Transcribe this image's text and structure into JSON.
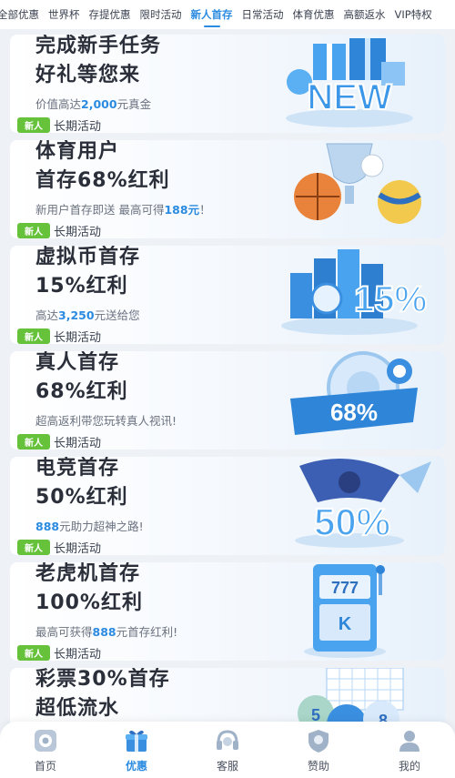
{
  "tabs": [
    {
      "label": "全部优惠"
    },
    {
      "label": "世界杯"
    },
    {
      "label": "存提优惠"
    },
    {
      "label": "限时活动"
    },
    {
      "label": "新人首存"
    },
    {
      "label": "日常活动"
    },
    {
      "label": "体育优惠"
    },
    {
      "label": "高额返水"
    },
    {
      "label": "VIP特权"
    }
  ],
  "active_tab": "新人首存",
  "cards": [
    {
      "title1": "完成新手任务",
      "title2": "好礼等您来",
      "desc_pre": "价值高达",
      "desc_hl": "2,000",
      "desc_post": "元真金",
      "badge": "新人",
      "period": "长期活动",
      "art": "new-gift-boxes"
    },
    {
      "title1": "体育用户",
      "title2": "首存68%红利",
      "desc_pre": "新用户首存即送 最高可得",
      "desc_hl": "188元",
      "desc_post": "！",
      "badge": "新人",
      "period": "长期活动",
      "art": "trophy-balls"
    },
    {
      "title1": "虚拟币首存",
      "title2": "15%红利",
      "desc_pre": "高达",
      "desc_hl": "3,250",
      "desc_post": "元送给您",
      "badge": "新人",
      "period": "长期活动",
      "art": "coin-stacks-15",
      "art_text": "15%"
    },
    {
      "title1": "真人首存",
      "title2": "68%红利",
      "desc_pre": "超高返利带您玩转真人视讯!",
      "desc_hl": "",
      "desc_post": "",
      "badge": "新人",
      "period": "长期活动",
      "art": "roulette-chips",
      "art_text": "68%"
    },
    {
      "title1": "电竞首存",
      "title2": "50%红利",
      "desc_pre": "",
      "desc_hl": "888",
      "desc_post": "元助力超神之路!",
      "badge": "新人",
      "period": "长期活动",
      "art": "esports-hero",
      "art_text": "50%"
    },
    {
      "title1": "老虎机首存",
      "title2": "100%红利",
      "desc_pre": "最高可获得",
      "desc_hl": "888",
      "desc_post": "元首存红利!",
      "badge": "新人",
      "period": "长期活动",
      "art": "slot-machine",
      "art_text": "777"
    },
    {
      "title1": "彩票30%首存",
      "title2": "超低流水",
      "desc_pre": "",
      "desc_hl": "",
      "desc_post": "",
      "badge": "",
      "period": "",
      "art": "lottery-balls",
      "art_text": "5 8"
    }
  ],
  "nav": [
    {
      "label": "首页",
      "icon": "home-icon"
    },
    {
      "label": "优惠",
      "icon": "gift-icon"
    },
    {
      "label": "客服",
      "icon": "headset-icon"
    },
    {
      "label": "赞助",
      "icon": "sponsor-icon"
    },
    {
      "label": "我的",
      "icon": "user-icon"
    }
  ],
  "active_nav": "优惠",
  "colors": {
    "accent": "#2a8be0",
    "badge": "#66c23a",
    "title": "#2a2f3a",
    "desc": "#6b7280"
  }
}
